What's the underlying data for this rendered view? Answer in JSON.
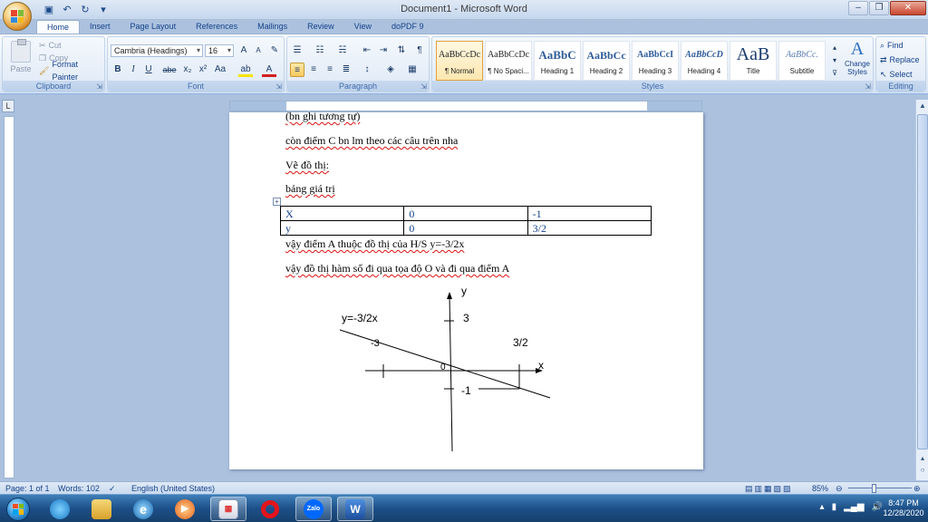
{
  "window": {
    "title": "Document1 - Microsoft Word",
    "minimize": "–",
    "restore": "❐",
    "close": "✕"
  },
  "qat": {
    "save": "▣",
    "undo": "↶",
    "redo": "↻",
    "more": "▾"
  },
  "tabs": [
    {
      "label": "Home"
    },
    {
      "label": "Insert"
    },
    {
      "label": "Page Layout"
    },
    {
      "label": "References"
    },
    {
      "label": "Mailings"
    },
    {
      "label": "Review"
    },
    {
      "label": "View"
    },
    {
      "label": "doPDF 9"
    }
  ],
  "clipboard": {
    "paste": "Paste",
    "cut": "Cut",
    "copy": "Copy",
    "format_painter": "Format Painter",
    "label": "Clipboard"
  },
  "font": {
    "family": "Cambria (Headings)",
    "size": "16",
    "label": "Font",
    "grow": "A",
    "shrink": "A",
    "clear": "✎",
    "bold": "B",
    "italic": "I",
    "underline": "U",
    "strike": "abe",
    "subscript": "x₂",
    "superscript": "x²",
    "change_case": "Aa",
    "highlight": "ab",
    "color": "A"
  },
  "paragraph": {
    "label": "Paragraph",
    "pilcrow": "¶",
    "sort": "⇅"
  },
  "styles": {
    "label": "Styles",
    "items": [
      {
        "sample": "AaBbCcDc",
        "name": "¶ Normal"
      },
      {
        "sample": "AaBbCcDc",
        "name": "¶ No Spaci..."
      },
      {
        "sample": "AaBbC",
        "name": "Heading 1"
      },
      {
        "sample": "AaBbCc",
        "name": "Heading 2"
      },
      {
        "sample": "AaBbCcI",
        "name": "Heading 3"
      },
      {
        "sample": "AaBbCcD",
        "name": "Heading 4"
      },
      {
        "sample": "AaB",
        "name": "Title"
      },
      {
        "sample": "AaBbCc.",
        "name": "Subtitle"
      }
    ],
    "change_styles": "Change Styles"
  },
  "editing": {
    "label": "Editing",
    "find": "Find",
    "replace": "Replace",
    "select": "Select"
  },
  "document": {
    "line1": "(bn ghi tương tự)",
    "line2": "còn điểm C bn lm theo các câu trên nha",
    "line3": "Vẽ đồ thị:",
    "line4": "bảng  giá trị",
    "table": [
      [
        "X",
        "0",
        "-1"
      ],
      [
        "y",
        "0",
        "3/2"
      ]
    ],
    "line5": "vậy điểm A thuộc đồ thị của H/S y=-3/2x",
    "line6": "vậy đồ thị hàm số đi qua tọa độ O và  đi qua điểm A",
    "graph": {
      "equation": "y=-3/2x",
      "y_axis": "y",
      "x_axis": "x",
      "origin": "0",
      "label_3": "3",
      "label_neg3": "-3",
      "label_3_2": "3/2",
      "label_neg1": "-1"
    }
  },
  "statusbar": {
    "page": "Page: 1 of 1",
    "words": "Words: 102",
    "language": "English (United States)",
    "zoom": "85%"
  },
  "taskbar": {
    "zalo": "Zalo",
    "word": "W",
    "time": "8:47 PM",
    "date": "12/28/2020"
  }
}
